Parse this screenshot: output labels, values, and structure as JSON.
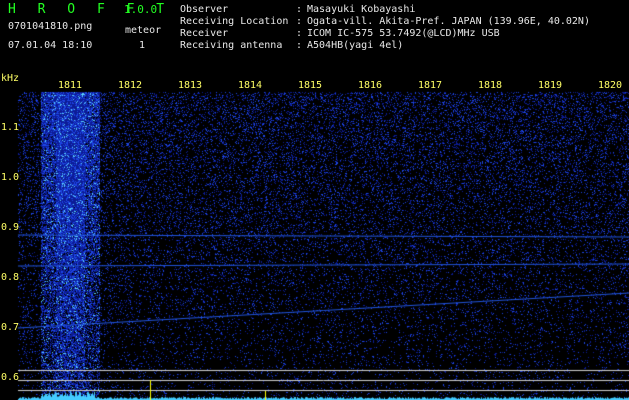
{
  "header": {
    "app_title": "H R O F F T",
    "version": "1.0.0",
    "file_name": "0701041810.png",
    "date_time": "07.01.04 18:10",
    "count_label": "meteor",
    "count_value": "1",
    "info": [
      {
        "label": "Observer",
        "sep": ":",
        "value": "Masayuki Kobayashi"
      },
      {
        "label": "Receiving Location",
        "sep": ":",
        "value": "Ogata-vill. Akita-Pref. JAPAN (139.96E, 40.02N)"
      },
      {
        "label": "Receiver",
        "sep": ":",
        "value": "ICOM IC-575 53.7492(@LCD)MHz USB"
      },
      {
        "label": "Receiving antenna",
        "sep": ":",
        "value": "A504HB(yagi 4el)"
      }
    ]
  },
  "plot": {
    "y_unit": "kHz",
    "y_ticks": [
      "1.1",
      "1.0",
      "0.9",
      "0.8",
      "0.7",
      "0.6"
    ],
    "x_ticks": [
      "1811",
      "1812",
      "1813",
      "1814",
      "1815",
      "1816",
      "1817",
      "1818",
      "1819",
      "1820"
    ],
    "colors": {
      "background": "#000000",
      "noise_dark": "#0a1a88",
      "noise_mid": "#1a44dd",
      "noise_bright": "#33aaff",
      "tick_text": "#ffff66",
      "header_accent": "#22ff22",
      "ref_lines": "#cfcfcf",
      "signal_trace": "#ffff00",
      "baseline": "#44ccff"
    }
  }
}
